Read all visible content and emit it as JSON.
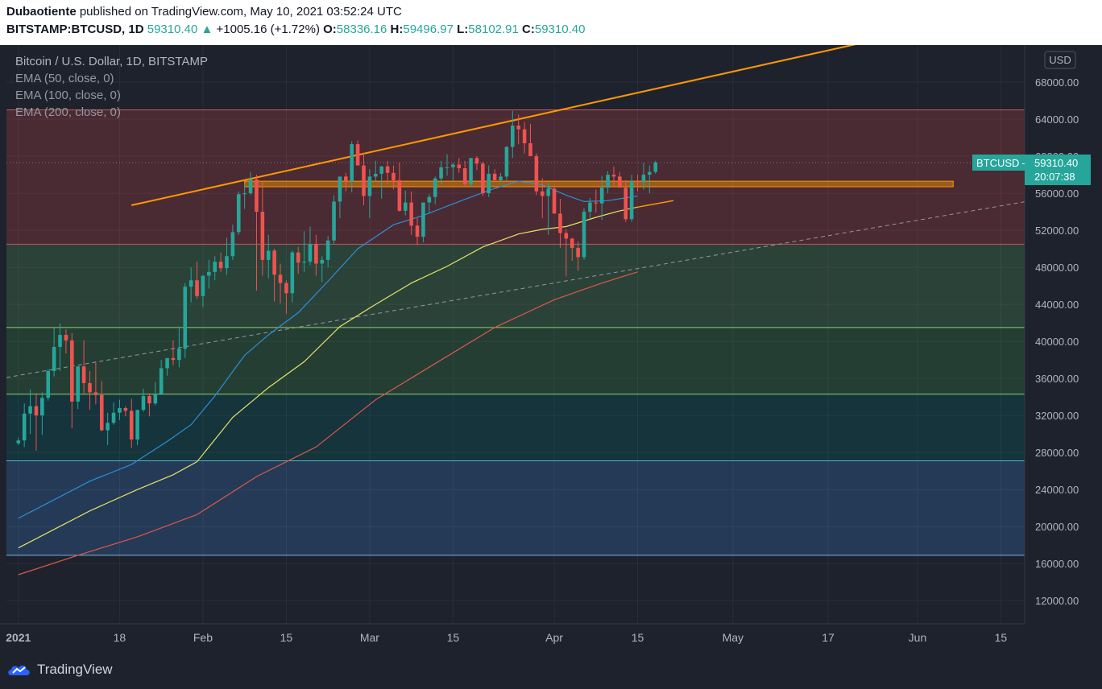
{
  "header": {
    "publisher": "Dubaotiente",
    "published_text": "published on TradingView.com, May 10, 2021 03:52:24 UTC",
    "symbol": "BITSTAMP:BTCUSD, 1D",
    "last": "59310.40",
    "change": "+1005.16 (+1.72%)",
    "o_label": "O:",
    "o": "58336.16",
    "h_label": "H:",
    "h": "59496.97",
    "l_label": "L:",
    "l": "58102.91",
    "c_label": "C:",
    "c": "59310.40"
  },
  "legend": {
    "title": "Bitcoin / U.S. Dollar, 1D, BITSTAMP",
    "ema50": "EMA (50, close, 0)",
    "ema100": "EMA (100, close, 0)",
    "ema200": "EMA (200, close, 0)"
  },
  "price_badge": {
    "symbol": "BTCUSD",
    "price": "59310.40",
    "countdown": "20:07:38"
  },
  "footer": {
    "brand": "TradingView"
  },
  "colors": {
    "up": "#26a69a",
    "down": "#ef5350",
    "ema50": "#2d8fd5",
    "ema100": "#e8e366",
    "ema200": "#e0574a",
    "trendline": "#ff9800",
    "zone_red": "#5a2930",
    "zone_green": "#2c4a3a",
    "zone_teal": "#16343a",
    "zone_blue": "#253a57",
    "background": "#1e222d"
  },
  "chart_data": {
    "type": "candlestick",
    "title": "Bitcoin / U.S. Dollar, 1D, BITSTAMP",
    "currency": "USD",
    "ylim": [
      9500,
      72000
    ],
    "y_ticks": [
      "68000.00",
      "64000.00",
      "60000.00",
      "56000.00",
      "52000.00",
      "48000.00",
      "44000.00",
      "40000.00",
      "36000.00",
      "32000.00",
      "28000.00",
      "24000.00",
      "20000.00",
      "16000.00",
      "12000.00"
    ],
    "x_ticks": [
      {
        "label": "2021",
        "date": "2021-01-01",
        "bold": true
      },
      {
        "label": "18",
        "date": "2021-01-18"
      },
      {
        "label": "Feb",
        "date": "2021-02-01"
      },
      {
        "label": "15",
        "date": "2021-02-15"
      },
      {
        "label": "Mar",
        "date": "2021-03-01"
      },
      {
        "label": "15",
        "date": "2021-03-15"
      },
      {
        "label": "Apr",
        "date": "2021-04-01"
      },
      {
        "label": "15",
        "date": "2021-04-15"
      },
      {
        "label": "May",
        "date": "2021-05-01"
      },
      {
        "label": "17",
        "date": "2021-05-17"
      },
      {
        "label": "Jun",
        "date": "2021-06-01"
      },
      {
        "label": "15",
        "date": "2021-06-15"
      }
    ],
    "x_range": [
      "2020-12-30",
      "2021-06-19"
    ],
    "start_date": "2021-01-01",
    "candles": [
      [
        29000,
        29600,
        28800,
        29300
      ],
      [
        29300,
        33300,
        28600,
        32200
      ],
      [
        32200,
        34800,
        30000,
        33000
      ],
      [
        33000,
        34400,
        28200,
        32000
      ],
      [
        32000,
        34500,
        29900,
        33900
      ],
      [
        33900,
        37000,
        33600,
        36800
      ],
      [
        36800,
        41500,
        36200,
        39400
      ],
      [
        39400,
        41950,
        36800,
        40700
      ],
      [
        40700,
        41300,
        38700,
        40100
      ],
      [
        40100,
        40900,
        30600,
        33500
      ],
      [
        33500,
        37300,
        32700,
        37300
      ],
      [
        37300,
        40100,
        34400,
        35500
      ],
      [
        35500,
        36800,
        32600,
        34500
      ],
      [
        34500,
        37800,
        33200,
        34200
      ],
      [
        34200,
        35700,
        30300,
        30400
      ],
      [
        30400,
        32300,
        28800,
        31200
      ],
      [
        31200,
        33400,
        31000,
        32300
      ],
      [
        32300,
        33700,
        31500,
        32800
      ],
      [
        32800,
        33000,
        31900,
        32500
      ],
      [
        32500,
        33800,
        28500,
        29400
      ],
      [
        29400,
        32600,
        28800,
        32600
      ],
      [
        32600,
        34900,
        32400,
        34100
      ],
      [
        34100,
        34400,
        31900,
        33300
      ],
      [
        33300,
        35600,
        33100,
        34300
      ],
      [
        34300,
        38000,
        34200,
        37100
      ],
      [
        37100,
        38200,
        36300,
        38200
      ],
      [
        38200,
        40100,
        37400,
        38000
      ],
      [
        38000,
        41500,
        37200,
        39200
      ],
      [
        39200,
        46300,
        38200,
        45900
      ],
      [
        45900,
        48000,
        44200,
        46600
      ],
      [
        46600,
        48600,
        44600,
        44900
      ],
      [
        44900,
        47100,
        43700,
        47100
      ],
      [
        47100,
        48800,
        45700,
        47500
      ],
      [
        47500,
        49200,
        46600,
        48600
      ],
      [
        48600,
        49600,
        47500,
        47900
      ],
      [
        47900,
        51200,
        47200,
        49200
      ],
      [
        49200,
        52600,
        48800,
        51800
      ],
      [
        51800,
        56200,
        51500,
        55900
      ],
      [
        55900,
        57000,
        54300,
        56000
      ],
      [
        56000,
        58300,
        55800,
        57500
      ],
      [
        57500,
        58000,
        45500,
        54000
      ],
      [
        54000,
        57200,
        47100,
        48800
      ],
      [
        48800,
        51500,
        46800,
        49800
      ],
      [
        49800,
        50000,
        44300,
        47200
      ],
      [
        47200,
        48400,
        44100,
        46300
      ],
      [
        46300,
        46600,
        43000,
        45200
      ],
      [
        45200,
        49800,
        44200,
        49600
      ],
      [
        49600,
        50200,
        47300,
        48500
      ],
      [
        48500,
        51900,
        47500,
        48600
      ],
      [
        48600,
        52400,
        48200,
        50500
      ],
      [
        50500,
        51500,
        47100,
        48400
      ],
      [
        48400,
        49200,
        46400,
        48800
      ],
      [
        48800,
        51400,
        48000,
        50900
      ],
      [
        50900,
        55800,
        50500,
        55100
      ],
      [
        55100,
        56500,
        53300,
        57800
      ],
      [
        57800,
        58200,
        56200,
        57300
      ],
      [
        57300,
        61600,
        56100,
        61300
      ],
      [
        61300,
        61700,
        59300,
        59000
      ],
      [
        59000,
        60400,
        54700,
        55700
      ],
      [
        55700,
        58600,
        53300,
        57800
      ],
      [
        57800,
        59500,
        57300,
        58100
      ],
      [
        58100,
        58900,
        55400,
        58900
      ],
      [
        58900,
        59500,
        57000,
        58200
      ],
      [
        58200,
        59000,
        56400,
        57400
      ],
      [
        57400,
        59300,
        54000,
        54100
      ],
      [
        54100,
        56300,
        53600,
        55000
      ],
      [
        55000,
        56200,
        51500,
        52500
      ],
      [
        52500,
        53300,
        50400,
        51300
      ],
      [
        51300,
        55000,
        50700,
        55000
      ],
      [
        55000,
        55900,
        53800,
        55600
      ],
      [
        55600,
        57800,
        54800,
        57600
      ],
      [
        57600,
        59500,
        57000,
        58800
      ],
      [
        58800,
        60200,
        57900,
        58800
      ],
      [
        58800,
        59300,
        57300,
        59100
      ],
      [
        59100,
        59800,
        58200,
        58700
      ],
      [
        58700,
        59500,
        56700,
        57000
      ],
      [
        57000,
        59800,
        56800,
        59800
      ],
      [
        59800,
        60000,
        58500,
        59200
      ],
      [
        59200,
        59400,
        55700,
        56000
      ],
      [
        56000,
        59000,
        55600,
        58100
      ],
      [
        58100,
        58600,
        57400,
        57400
      ],
      [
        57400,
        58200,
        57200,
        57800
      ],
      [
        57800,
        61100,
        57300,
        61000
      ],
      [
        61000,
        64900,
        59800,
        63300
      ],
      [
        63300,
        64500,
        61300,
        62900
      ],
      [
        62900,
        63700,
        60300,
        61400
      ],
      [
        61400,
        63500,
        60000,
        60000
      ],
      [
        60000,
        60300,
        55800,
        56200
      ],
      [
        56200,
        57600,
        53300,
        55700
      ],
      [
        55700,
        57100,
        51500,
        56500
      ],
      [
        56500,
        56800,
        53800,
        53800
      ],
      [
        53800,
        55400,
        50100,
        51700
      ],
      [
        51700,
        52100,
        47000,
        51100
      ],
      [
        51100,
        51200,
        48700,
        50100
      ],
      [
        50100,
        50800,
        47600,
        49100
      ],
      [
        49100,
        54400,
        48800,
        54000
      ],
      [
        54000,
        55500,
        53200,
        55000
      ],
      [
        55000,
        56400,
        53900,
        54900
      ],
      [
        54900,
        57900,
        53100,
        56600
      ],
      [
        56600,
        58400,
        56000,
        58000
      ],
      [
        58000,
        58900,
        56800,
        57800
      ],
      [
        57800,
        58300,
        56800,
        56600
      ],
      [
        56600,
        57400,
        52900,
        53200
      ],
      [
        53200,
        58000,
        52900,
        57300
      ],
      [
        57300,
        58000,
        56200,
        57200
      ],
      [
        57200,
        59300,
        56400,
        58000
      ],
      [
        58000,
        59000,
        56000,
        58300
      ],
      [
        58300,
        59500,
        58100,
        59310
      ]
    ],
    "ema50": [
      [
        0,
        20900
      ],
      [
        12,
        24900
      ],
      [
        19,
        26700
      ],
      [
        25,
        29200
      ],
      [
        29,
        31000
      ],
      [
        33,
        34100
      ],
      [
        38,
        38500
      ],
      [
        42,
        40700
      ],
      [
        47,
        43100
      ],
      [
        52,
        46500
      ],
      [
        57,
        50000
      ],
      [
        63,
        52600
      ],
      [
        68,
        53600
      ],
      [
        74,
        55100
      ],
      [
        79,
        56300
      ],
      [
        84,
        57300
      ],
      [
        88,
        56900
      ],
      [
        92,
        55800
      ],
      [
        95,
        55100
      ],
      [
        99,
        55200
      ],
      [
        104,
        55700
      ]
    ],
    "ema100": [
      [
        0,
        17700
      ],
      [
        12,
        21700
      ],
      [
        20,
        24000
      ],
      [
        26,
        25600
      ],
      [
        30,
        27000
      ],
      [
        36,
        31800
      ],
      [
        42,
        35000
      ],
      [
        48,
        37800
      ],
      [
        54,
        41600
      ],
      [
        60,
        44000
      ],
      [
        66,
        46300
      ],
      [
        72,
        48100
      ],
      [
        78,
        50200
      ],
      [
        84,
        51600
      ],
      [
        88,
        52100
      ],
      [
        92,
        52400
      ],
      [
        97,
        53400
      ],
      [
        101,
        54100
      ],
      [
        104,
        54500
      ]
    ],
    "ema200": [
      [
        0,
        14800
      ],
      [
        10,
        16900
      ],
      [
        20,
        18900
      ],
      [
        30,
        21300
      ],
      [
        40,
        25400
      ],
      [
        50,
        28600
      ],
      [
        60,
        33700
      ],
      [
        70,
        37600
      ],
      [
        80,
        41500
      ],
      [
        90,
        44500
      ],
      [
        98,
        46300
      ],
      [
        104,
        47500
      ]
    ],
    "zones": [
      {
        "from": 50500,
        "to": 65000,
        "color": "red"
      },
      {
        "from": 41500,
        "to": 50500,
        "color": "green"
      },
      {
        "from": 34300,
        "to": 41500,
        "color": "green2"
      },
      {
        "from": 27100,
        "to": 34300,
        "color": "teal"
      },
      {
        "from": 16900,
        "to": 27100,
        "color": "blue"
      }
    ],
    "levels": [
      65000,
      50500,
      41500,
      34300,
      27100,
      16900
    ],
    "resistance_band": [
      56700,
      57300
    ],
    "trendline_orange": [
      [
        19,
        54700
      ],
      [
        161,
        75000
      ]
    ],
    "trendline_dashed": [
      [
        -2,
        36100
      ],
      [
        180,
        56300
      ]
    ],
    "ema100_projection": [
      [
        104,
        54500
      ],
      [
        110,
        55200
      ]
    ]
  }
}
